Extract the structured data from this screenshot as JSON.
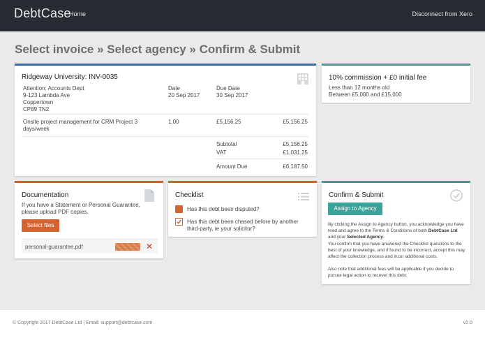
{
  "header": {
    "brand": "DebtCase",
    "nav_home": "Home",
    "disconnect": "Disconnect from Xero"
  },
  "page_title": "Select invoice » Select agency » Confirm & Submit",
  "invoice": {
    "title": "Ridgeway University: INV-0035",
    "icon": "building-icon",
    "address_lines": [
      "Attention: Accounts Dept",
      "9-123 Lambda Ave",
      "Coppertown",
      "CP89 TN2"
    ],
    "date_label": "Date",
    "date_value": "20 Sep 2017",
    "due_label": "Due Date",
    "due_value": "30 Sep 2017",
    "line_item": {
      "description": "Onsite project management for CRM Project 3 days/week",
      "quantity": "1.00",
      "unit_price": "£5,156.25",
      "amount": "£5,156.25"
    },
    "subtotal_label": "Subtotal",
    "subtotal_value": "£5,156.25",
    "vat_label": "VAT",
    "vat_value": "£1,031.25",
    "amount_due_label": "Amount Due",
    "amount_due_value": "£6,187.50"
  },
  "commission": {
    "title": "10% commission + £0 initial fee",
    "line1": "Less than 12 months old",
    "line2": "Between £5,000 and £15,000"
  },
  "documentation": {
    "title": "Documentation",
    "description": "If you have a Statement or Personal Guarantee, please upload PDF copies.",
    "select_files": "Select files",
    "file_name": "personal-guarantee.pdf",
    "upload_progress": 1.0
  },
  "checklist": {
    "title": "Checklist",
    "items": [
      {
        "label": "Has this debt been disputed?",
        "checked": false
      },
      {
        "label": "Has this debt been chased before by another third-party, ie your solicitor?",
        "checked": true
      }
    ]
  },
  "confirm": {
    "title": "Confirm & Submit",
    "button": "Assign to Agency",
    "p1_a": "By clicking the Assign to Agency button, you acknowledge you have read and agree to the Terms & Conditions of both ",
    "p1_b1": "DebtCase Ltd",
    "p1_c": " and your ",
    "p1_b2": "Selected Agency",
    "p1_d": ".",
    "p2": "You confirm that you have answered the Checklist questions to the best of your knowledge, and if found to be incorrect, accept this may affect the collection process and incur additional costs.",
    "p3": "Also note that additional fees will be applicable if you decide to pursue legal action to recover this debt."
  },
  "footer": {
    "copyright": "© Copyright 2017 DebtCase Ltd  |  Email: support@debtcase.com",
    "version": "v2.0"
  },
  "colors": {
    "topbar": "#262c31",
    "blue_accent": "#3d6aa4",
    "orange_accent": "#d4632f",
    "teal_accent": "#3aa39a"
  }
}
